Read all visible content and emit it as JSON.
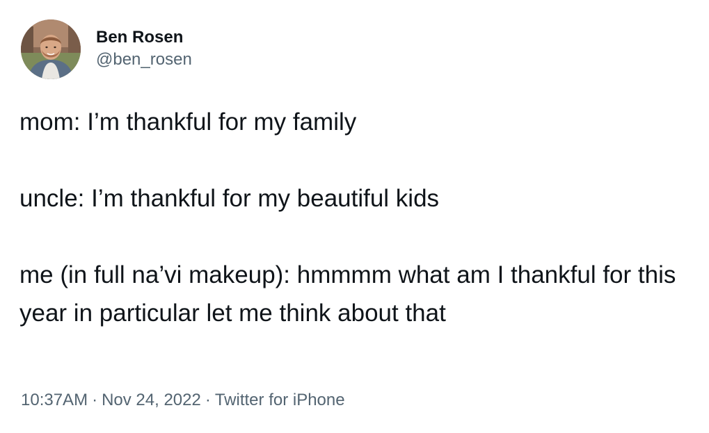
{
  "author": {
    "display_name": "Ben Rosen",
    "handle": "@ben_rosen",
    "avatar_icon": "profile-photo"
  },
  "tweet": {
    "paragraphs": [
      "mom: I’m thankful for my family",
      "uncle: I’m thankful for my beautiful kids",
      "me (in full na’vi makeup): hmmmm what am I thankful for this year in particular let me think about that"
    ]
  },
  "meta": {
    "time": "10:37AM",
    "separator": "·",
    "date": "Nov 24, 2022",
    "source": "Twitter for iPhone"
  },
  "colors": {
    "text": "#0f1419",
    "secondary": "#536471",
    "background": "#ffffff"
  }
}
